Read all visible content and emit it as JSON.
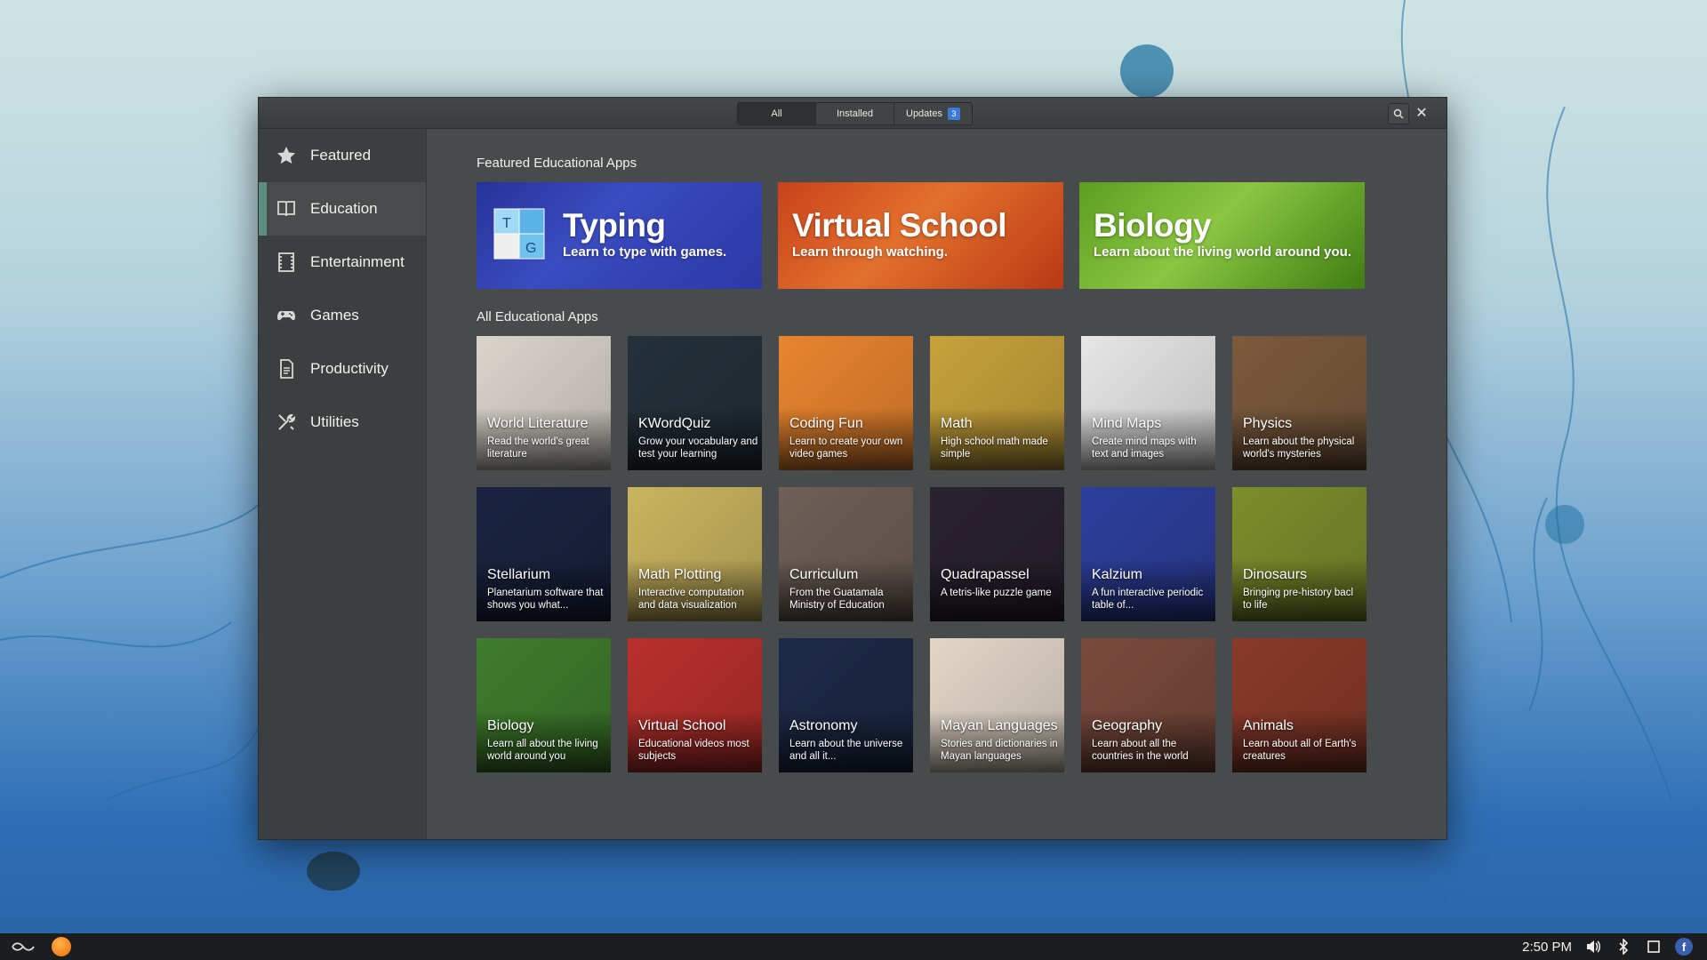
{
  "window": {
    "filters": {
      "all": "All",
      "installed": "Installed",
      "updates": "Updates",
      "updates_count": "3"
    }
  },
  "sidebar": {
    "items": [
      {
        "label": "Featured",
        "icon": "star-icon"
      },
      {
        "label": "Education",
        "icon": "book-icon",
        "active": true
      },
      {
        "label": "Entertainment",
        "icon": "film-icon"
      },
      {
        "label": "Games",
        "icon": "gamepad-icon"
      },
      {
        "label": "Productivity",
        "icon": "document-icon"
      },
      {
        "label": "Utilities",
        "icon": "tools-icon"
      }
    ]
  },
  "main": {
    "featured_title": "Featured Educational Apps",
    "featured": [
      {
        "title": "Typing",
        "subtitle": "Learn to type with games."
      },
      {
        "title": "Virtual School",
        "subtitle": "Learn through watching."
      },
      {
        "title": "Biology",
        "subtitle": "Learn about the living world around you."
      }
    ],
    "all_title": "All Educational Apps",
    "apps": [
      {
        "name": "World Literature",
        "desc": "Read the world's great literature",
        "color": "#d9d4cc"
      },
      {
        "name": "KWordQuiz",
        "desc": "Grow your vocabulary and test your learning",
        "color": "#24303a"
      },
      {
        "name": "Coding Fun",
        "desc": "Learn to create your own video games",
        "color": "#e8842e"
      },
      {
        "name": "Math",
        "desc": "High school math made simple",
        "color": "#c7a23a"
      },
      {
        "name": "Mind Maps",
        "desc": "Create mind maps with text and images",
        "color": "#e6e6e6"
      },
      {
        "name": "Physics",
        "desc": "Learn about the physical world's mysteries",
        "color": "#7b5a3d"
      },
      {
        "name": "Stellarium",
        "desc": "Planetarium software that shows you what...",
        "color": "#1a2340"
      },
      {
        "name": "Math Plotting",
        "desc": "Interactive computation and data visualization",
        "color": "#c9b45e"
      },
      {
        "name": "Curriculum",
        "desc": "From the Guatamala Ministry of Education",
        "color": "#6e5f57"
      },
      {
        "name": "Quadrapassel",
        "desc": "A tetris-like puzzle game",
        "color": "#2a2230"
      },
      {
        "name": "Kalzium",
        "desc": "A fun interactive periodic table of...",
        "color": "#2d3f9c"
      },
      {
        "name": "Dinosaurs",
        "desc": "Bringing pre-history bacl to life",
        "color": "#7c8d2b"
      },
      {
        "name": "Biology",
        "desc": "Learn all about the living world around you",
        "color": "#3f7c2c"
      },
      {
        "name": "Virtual School",
        "desc": "Educational videos most subjects",
        "color": "#b8302c"
      },
      {
        "name": "Astronomy",
        "desc": "Learn about the universe and all it...",
        "color": "#1d2a47"
      },
      {
        "name": "Mayan Languages",
        "desc": "Stories and dictionaries in Mayan languages",
        "color": "#e2d6c8"
      },
      {
        "name": "Geography",
        "desc": "Learn about all the countries in the world",
        "color": "#7a4a3c"
      },
      {
        "name": "Animals",
        "desc": "Learn about all of Earth's creatures",
        "color": "#8a3a2a"
      }
    ]
  },
  "taskbar": {
    "clock": "2:50 PM",
    "icons": [
      "endless-logo-icon",
      "browser-icon",
      "volume-icon",
      "bluetooth-icon",
      "window-icon",
      "facebook-icon"
    ]
  }
}
